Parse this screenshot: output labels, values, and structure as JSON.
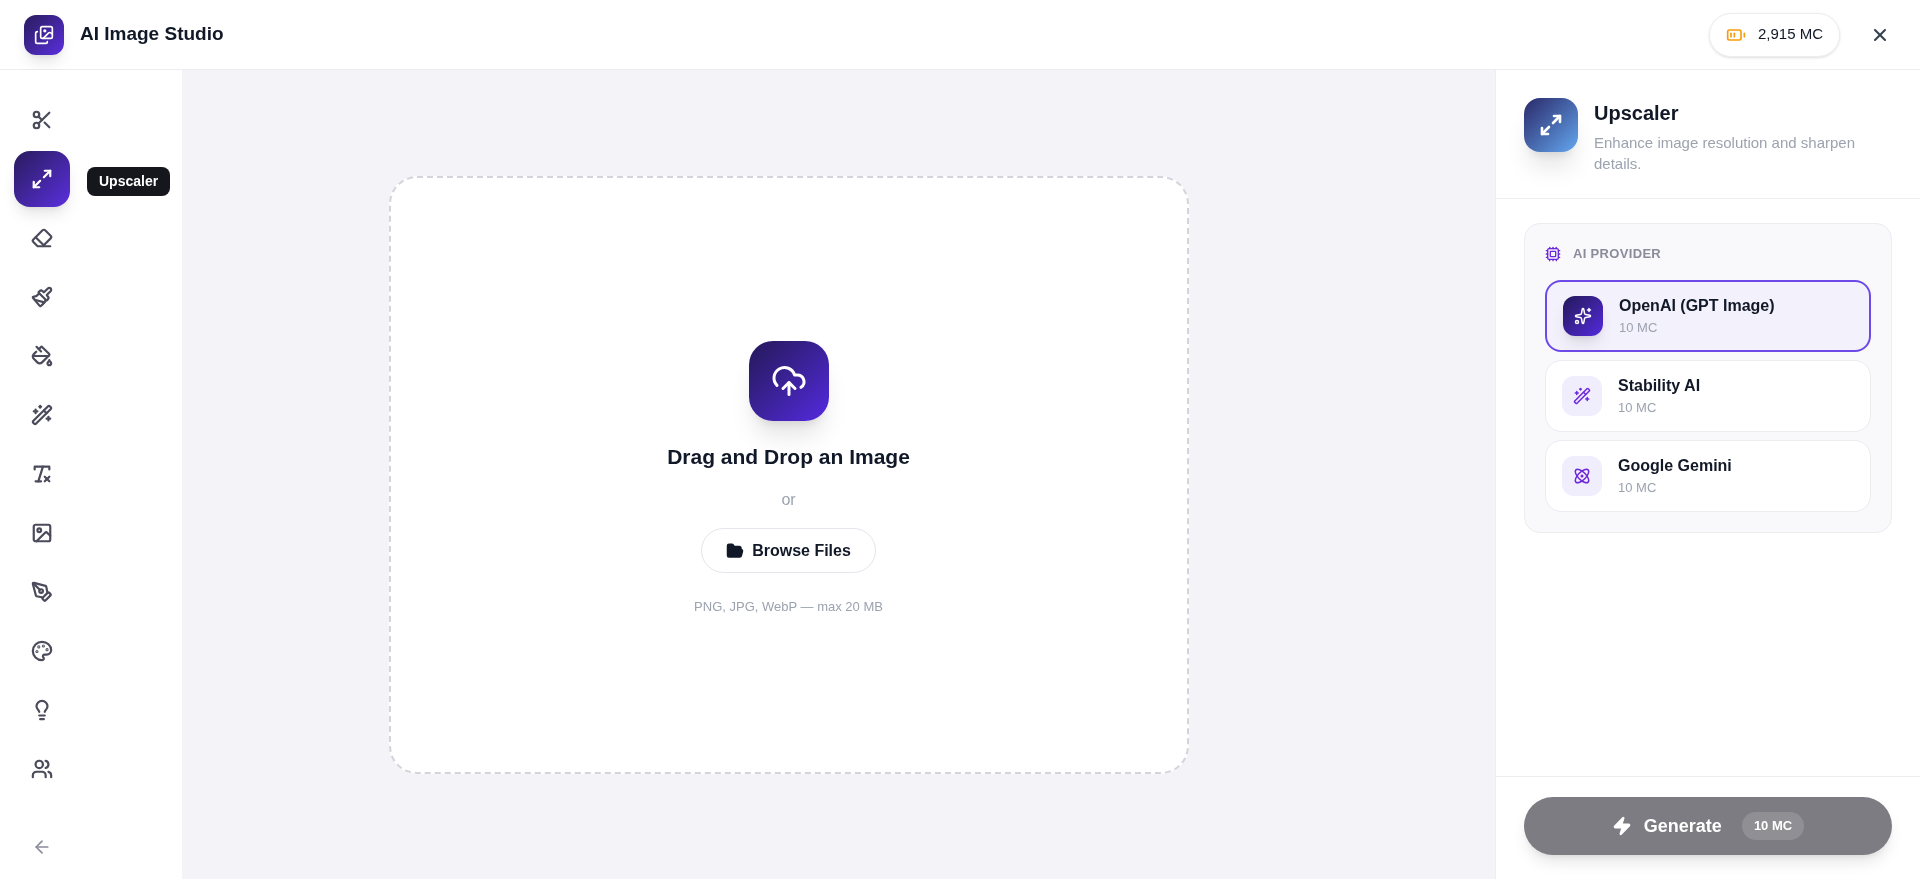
{
  "header": {
    "title": "AI Image Studio",
    "credits": "2,915 MC"
  },
  "sidebar": {
    "tools": [
      {
        "selected": false
      },
      {
        "selected": true
      },
      {
        "selected": false
      },
      {
        "selected": false
      },
      {
        "selected": false
      },
      {
        "selected": false
      },
      {
        "selected": false
      },
      {
        "selected": false
      },
      {
        "selected": false
      },
      {
        "selected": false
      },
      {
        "selected": false
      },
      {
        "selected": false
      }
    ],
    "tooltip": "Upscaler"
  },
  "dropzone": {
    "title": "Drag and Drop an Image",
    "separator": "or",
    "button": "Browse Files",
    "hint": "PNG, JPG, WebP — max 20 MB"
  },
  "panel": {
    "title": "Upscaler",
    "description": "Enhance image resolution and sharpen details.",
    "section_label": "AI PROVIDER",
    "providers": [
      {
        "name": "OpenAI (GPT Image)",
        "cost": "10 MC",
        "selected": true
      },
      {
        "name": "Stability AI",
        "cost": "10 MC",
        "selected": false
      },
      {
        "name": "Google Gemini",
        "cost": "10 MC",
        "selected": false
      }
    ],
    "generate": {
      "label": "Generate",
      "cost": "10 MC",
      "disabled": true
    }
  }
}
